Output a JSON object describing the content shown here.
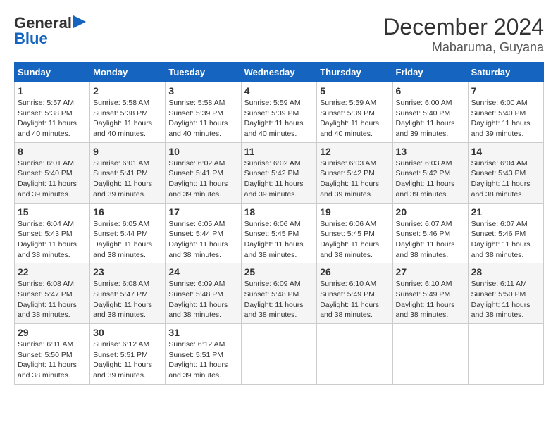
{
  "title": "December 2024",
  "subtitle": "Mabaruma, Guyana",
  "logo": {
    "line1": "General",
    "line2": "Blue"
  },
  "days_of_week": [
    "Sunday",
    "Monday",
    "Tuesday",
    "Wednesday",
    "Thursday",
    "Friday",
    "Saturday"
  ],
  "weeks": [
    [
      {
        "day": "1",
        "sunrise": "5:57 AM",
        "sunset": "5:38 PM",
        "daylight": "11 hours and 40 minutes."
      },
      {
        "day": "2",
        "sunrise": "5:58 AM",
        "sunset": "5:38 PM",
        "daylight": "11 hours and 40 minutes."
      },
      {
        "day": "3",
        "sunrise": "5:58 AM",
        "sunset": "5:39 PM",
        "daylight": "11 hours and 40 minutes."
      },
      {
        "day": "4",
        "sunrise": "5:59 AM",
        "sunset": "5:39 PM",
        "daylight": "11 hours and 40 minutes."
      },
      {
        "day": "5",
        "sunrise": "5:59 AM",
        "sunset": "5:39 PM",
        "daylight": "11 hours and 40 minutes."
      },
      {
        "day": "6",
        "sunrise": "6:00 AM",
        "sunset": "5:40 PM",
        "daylight": "11 hours and 39 minutes."
      },
      {
        "day": "7",
        "sunrise": "6:00 AM",
        "sunset": "5:40 PM",
        "daylight": "11 hours and 39 minutes."
      }
    ],
    [
      {
        "day": "8",
        "sunrise": "6:01 AM",
        "sunset": "5:40 PM",
        "daylight": "11 hours and 39 minutes."
      },
      {
        "day": "9",
        "sunrise": "6:01 AM",
        "sunset": "5:41 PM",
        "daylight": "11 hours and 39 minutes."
      },
      {
        "day": "10",
        "sunrise": "6:02 AM",
        "sunset": "5:41 PM",
        "daylight": "11 hours and 39 minutes."
      },
      {
        "day": "11",
        "sunrise": "6:02 AM",
        "sunset": "5:42 PM",
        "daylight": "11 hours and 39 minutes."
      },
      {
        "day": "12",
        "sunrise": "6:03 AM",
        "sunset": "5:42 PM",
        "daylight": "11 hours and 39 minutes."
      },
      {
        "day": "13",
        "sunrise": "6:03 AM",
        "sunset": "5:42 PM",
        "daylight": "11 hours and 39 minutes."
      },
      {
        "day": "14",
        "sunrise": "6:04 AM",
        "sunset": "5:43 PM",
        "daylight": "11 hours and 38 minutes."
      }
    ],
    [
      {
        "day": "15",
        "sunrise": "6:04 AM",
        "sunset": "5:43 PM",
        "daylight": "11 hours and 38 minutes."
      },
      {
        "day": "16",
        "sunrise": "6:05 AM",
        "sunset": "5:44 PM",
        "daylight": "11 hours and 38 minutes."
      },
      {
        "day": "17",
        "sunrise": "6:05 AM",
        "sunset": "5:44 PM",
        "daylight": "11 hours and 38 minutes."
      },
      {
        "day": "18",
        "sunrise": "6:06 AM",
        "sunset": "5:45 PM",
        "daylight": "11 hours and 38 minutes."
      },
      {
        "day": "19",
        "sunrise": "6:06 AM",
        "sunset": "5:45 PM",
        "daylight": "11 hours and 38 minutes."
      },
      {
        "day": "20",
        "sunrise": "6:07 AM",
        "sunset": "5:46 PM",
        "daylight": "11 hours and 38 minutes."
      },
      {
        "day": "21",
        "sunrise": "6:07 AM",
        "sunset": "5:46 PM",
        "daylight": "11 hours and 38 minutes."
      }
    ],
    [
      {
        "day": "22",
        "sunrise": "6:08 AM",
        "sunset": "5:47 PM",
        "daylight": "11 hours and 38 minutes."
      },
      {
        "day": "23",
        "sunrise": "6:08 AM",
        "sunset": "5:47 PM",
        "daylight": "11 hours and 38 minutes."
      },
      {
        "day": "24",
        "sunrise": "6:09 AM",
        "sunset": "5:48 PM",
        "daylight": "11 hours and 38 minutes."
      },
      {
        "day": "25",
        "sunrise": "6:09 AM",
        "sunset": "5:48 PM",
        "daylight": "11 hours and 38 minutes."
      },
      {
        "day": "26",
        "sunrise": "6:10 AM",
        "sunset": "5:49 PM",
        "daylight": "11 hours and 38 minutes."
      },
      {
        "day": "27",
        "sunrise": "6:10 AM",
        "sunset": "5:49 PM",
        "daylight": "11 hours and 38 minutes."
      },
      {
        "day": "28",
        "sunrise": "6:11 AM",
        "sunset": "5:50 PM",
        "daylight": "11 hours and 38 minutes."
      }
    ],
    [
      {
        "day": "29",
        "sunrise": "6:11 AM",
        "sunset": "5:50 PM",
        "daylight": "11 hours and 38 minutes."
      },
      {
        "day": "30",
        "sunrise": "6:12 AM",
        "sunset": "5:51 PM",
        "daylight": "11 hours and 39 minutes."
      },
      {
        "day": "31",
        "sunrise": "6:12 AM",
        "sunset": "5:51 PM",
        "daylight": "11 hours and 39 minutes."
      },
      null,
      null,
      null,
      null
    ]
  ]
}
